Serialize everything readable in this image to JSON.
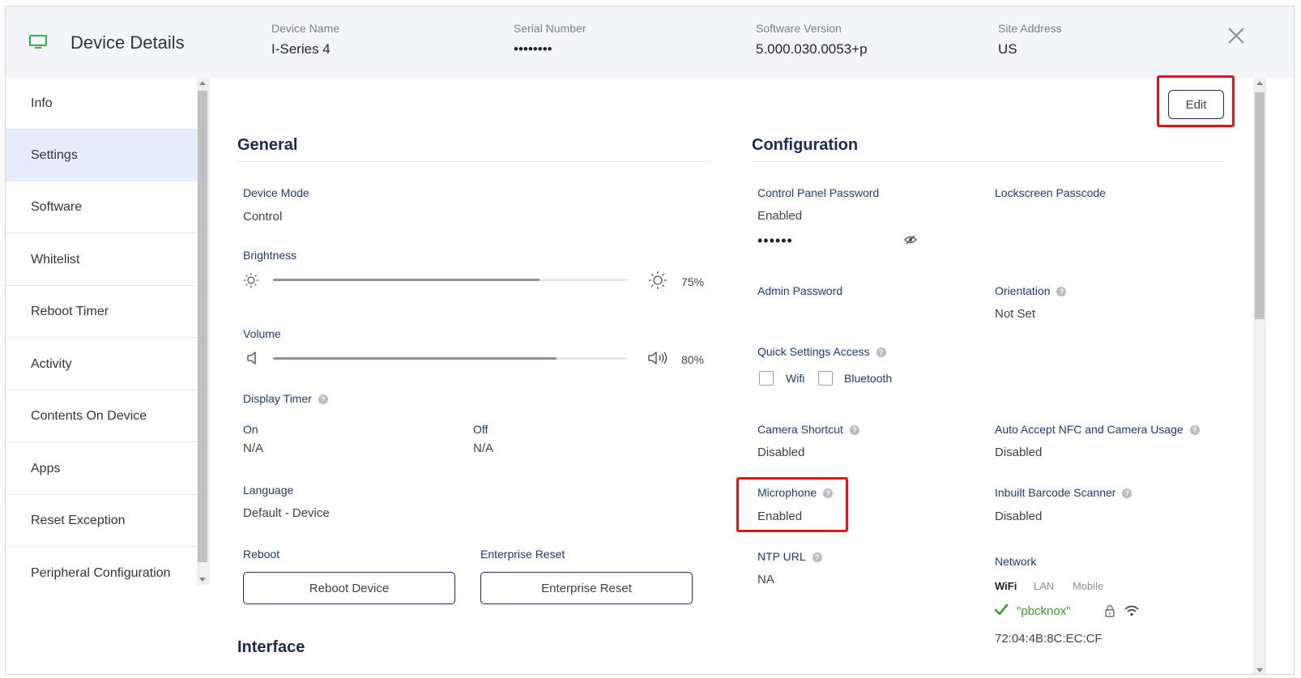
{
  "header": {
    "title": "Device Details",
    "fields": [
      {
        "label": "Device Name",
        "value": "I-Series 4"
      },
      {
        "label": "Serial Number",
        "value": "••••••••"
      },
      {
        "label": "Software Version",
        "value": "5.000.030.0053+p"
      },
      {
        "label": "Site Address",
        "value": "US"
      }
    ]
  },
  "sidebar": {
    "items": [
      {
        "label": "Info"
      },
      {
        "label": "Settings",
        "active": true
      },
      {
        "label": "Software"
      },
      {
        "label": "Whitelist"
      },
      {
        "label": "Reboot Timer"
      },
      {
        "label": "Activity"
      },
      {
        "label": "Contents On Device"
      },
      {
        "label": "Apps"
      },
      {
        "label": "Reset Exception"
      },
      {
        "label": "Peripheral Configuration"
      }
    ]
  },
  "toolbar": {
    "edit_label": "Edit"
  },
  "general": {
    "title": "General",
    "device_mode": {
      "label": "Device Mode",
      "value": "Control"
    },
    "brightness": {
      "label": "Brightness",
      "level": 0.75,
      "display": "75%"
    },
    "volume": {
      "label": "Volume",
      "level": 0.8,
      "display": "80%"
    },
    "display_timer": {
      "label": "Display Timer",
      "on": {
        "label": "On",
        "value": "N/A"
      },
      "off": {
        "label": "Off",
        "value": "N/A"
      }
    },
    "language": {
      "label": "Language",
      "value": "Default - Device"
    },
    "reboot": {
      "label": "Reboot",
      "button": "Reboot Device"
    },
    "enterprise_reset": {
      "label": "Enterprise Reset",
      "button": "Enterprise Reset"
    }
  },
  "interface": {
    "title": "Interface"
  },
  "configuration": {
    "title": "Configuration",
    "control_panel_password": {
      "label": "Control Panel Password",
      "value": "Enabled",
      "masked": "••••••"
    },
    "lockscreen_passcode": {
      "label": "Lockscreen Passcode"
    },
    "admin_password": {
      "label": "Admin Password"
    },
    "orientation": {
      "label": "Orientation",
      "value": "Not Set"
    },
    "quick_settings": {
      "label": "Quick Settings Access",
      "wifi": "Wifi",
      "bluetooth": "Bluetooth"
    },
    "camera_shortcut": {
      "label": "Camera Shortcut",
      "value": "Disabled"
    },
    "auto_accept_nfc": {
      "label": "Auto Accept NFC and Camera Usage",
      "value": "Disabled"
    },
    "microphone": {
      "label": "Microphone",
      "value": "Enabled"
    },
    "barcode_scanner": {
      "label": "Inbuilt Barcode Scanner",
      "value": "Disabled"
    },
    "ntp_url": {
      "label": "NTP URL",
      "value": "NA"
    },
    "network": {
      "label": "Network",
      "tabs": [
        "WiFi",
        "LAN",
        "Mobile"
      ],
      "active_tab": "WiFi",
      "ssid": "\"pbcknox\"",
      "mac": "72:04:4B:8C:EC:CF"
    }
  },
  "colors": {
    "accent": "#1d2b52",
    "label": "#1d3a78",
    "highlight": "#e8101c",
    "active_nav": "#e5ecfb",
    "ok": "#3a9d2a"
  }
}
